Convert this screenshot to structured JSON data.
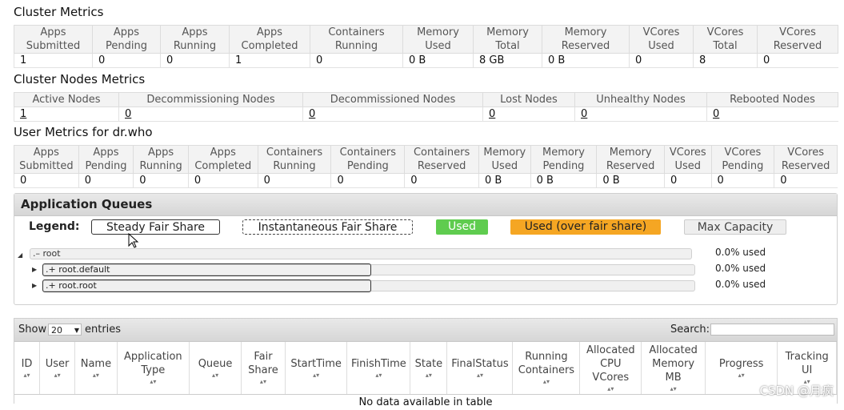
{
  "cluster_metrics": {
    "title": "Cluster Metrics",
    "headers": [
      [
        "Apps",
        "Submitted"
      ],
      [
        "Apps",
        "Pending"
      ],
      [
        "Apps",
        "Running"
      ],
      [
        "Apps",
        "Completed"
      ],
      [
        "Containers",
        "Running"
      ],
      [
        "Memory",
        "Used"
      ],
      [
        "Memory",
        "Total"
      ],
      [
        "Memory",
        "Reserved"
      ],
      [
        "VCores",
        "Used"
      ],
      [
        "VCores",
        "Total"
      ],
      [
        "VCores",
        "Reserved"
      ]
    ],
    "values": [
      "1",
      "0",
      "0",
      "1",
      "0",
      "0 B",
      "8 GB",
      "0 B",
      "0",
      "8",
      "0"
    ]
  },
  "nodes_metrics": {
    "title": "Cluster Nodes Metrics",
    "headers": [
      "Active Nodes",
      "Decommissioning Nodes",
      "Decommissioned Nodes",
      "Lost Nodes",
      "Unhealthy Nodes",
      "Rebooted Nodes"
    ],
    "values": [
      "1",
      "0",
      "0",
      "0",
      "0",
      "0"
    ]
  },
  "user_metrics": {
    "title": "User Metrics for dr.who",
    "headers": [
      [
        "Apps",
        "Submitted"
      ],
      [
        "Apps",
        "Pending"
      ],
      [
        "Apps",
        "Running"
      ],
      [
        "Apps",
        "Completed"
      ],
      [
        "Containers",
        "Running"
      ],
      [
        "Containers",
        "Pending"
      ],
      [
        "Containers",
        "Reserved"
      ],
      [
        "Memory",
        "Used"
      ],
      [
        "Memory",
        "Pending"
      ],
      [
        "Memory",
        "Reserved"
      ],
      [
        "VCores",
        "Used"
      ],
      [
        "VCores",
        "Pending"
      ],
      [
        "VCores",
        "Reserved"
      ]
    ],
    "values": [
      "0",
      "0",
      "0",
      "0",
      "0",
      "0",
      "0",
      "0 B",
      "0 B",
      "0 B",
      "0",
      "0",
      "0"
    ]
  },
  "queues": {
    "title": "Application Queues",
    "legend_label": "Legend:",
    "legend": {
      "steady": "Steady Fair Share",
      "instantaneous": "Instantaneous Fair Share",
      "used": "Used",
      "over": "Used (over fair share)",
      "max": "Max Capacity"
    },
    "root": {
      "label": ".– root",
      "pct": "0.0% used"
    },
    "children": [
      {
        "label": ".+ root.default",
        "pct": "0.0% used"
      },
      {
        "label": ".+ root.root",
        "pct": "0.0% used"
      }
    ]
  },
  "apps_table": {
    "show_label": "Show",
    "page_size": "20",
    "entries_label": "entries",
    "search_label": "Search:",
    "columns": [
      "ID",
      "User",
      "Name",
      "Application Type",
      "Queue",
      "Fair Share",
      "StartTime",
      "FinishTime",
      "State",
      "FinalStatus",
      "Running Containers",
      "Allocated CPU VCores",
      "Allocated Memory MB",
      "Progress",
      "Tracking UI"
    ],
    "empty_message": "No data available in table"
  },
  "watermark": "CSDN @月疯"
}
